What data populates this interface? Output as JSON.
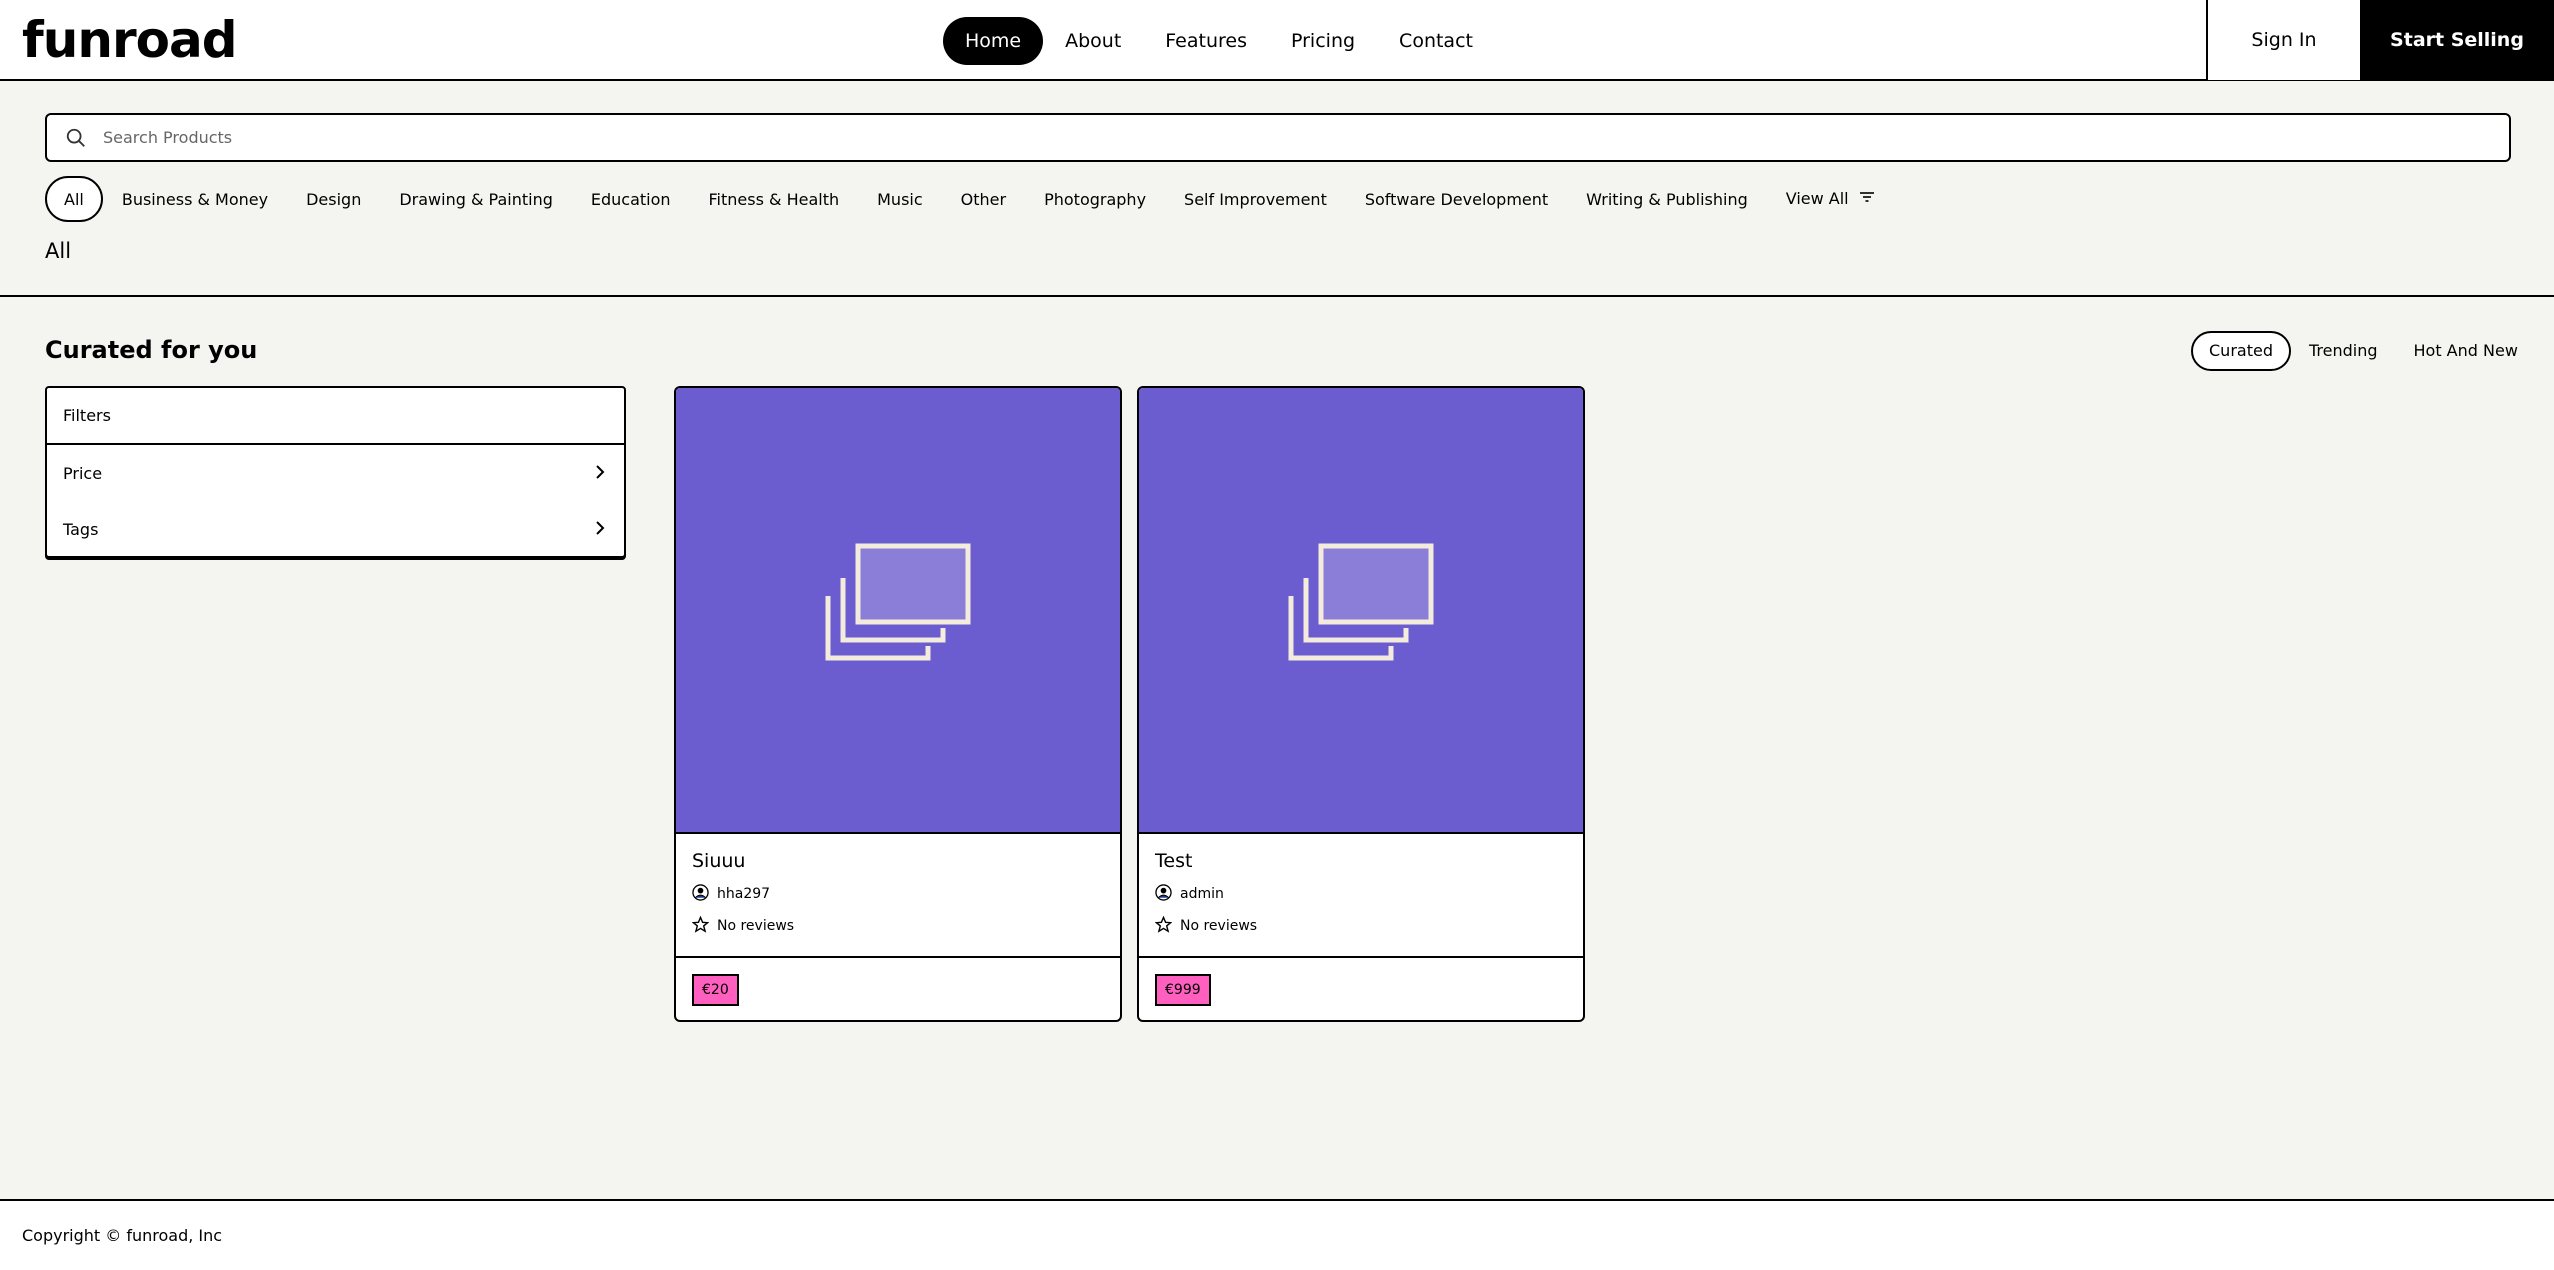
{
  "brand": {
    "logo_text": "funroad"
  },
  "nav": {
    "links": [
      "Home",
      "About",
      "Features",
      "Pricing",
      "Contact"
    ],
    "active": "Home",
    "sign_in_label": "Sign In",
    "start_selling_label": "Start Selling"
  },
  "search": {
    "placeholder": "Search Products",
    "icon": "search-icon"
  },
  "categories": {
    "items": [
      "All",
      "Business & Money",
      "Design",
      "Drawing & Painting",
      "Education",
      "Fitness & Health",
      "Music",
      "Other",
      "Photography",
      "Self Improvement",
      "Software Development",
      "Writing & Publishing"
    ],
    "active": "All",
    "view_all_label": "View All",
    "current_label": "All"
  },
  "main": {
    "section_title": "Curated for you",
    "sort_tabs": [
      "Curated",
      "Trending",
      "Hot And New"
    ],
    "active_sort": "Curated"
  },
  "filters": {
    "header": "Filters",
    "items": [
      "Price",
      "Tags"
    ]
  },
  "products": [
    {
      "title": "Siuuu",
      "author": "hha297",
      "reviews": "No reviews",
      "price": "€20"
    },
    {
      "title": "Test",
      "author": "admin",
      "reviews": "No reviews",
      "price": "€999"
    }
  ],
  "colors": {
    "background": "#f4f4f0",
    "card_image": "#6b5ccf",
    "price_tag": "#ff5fbf",
    "accent_dark": "#000000"
  },
  "footer": {
    "copyright": "Copyright © funroad, Inc"
  }
}
